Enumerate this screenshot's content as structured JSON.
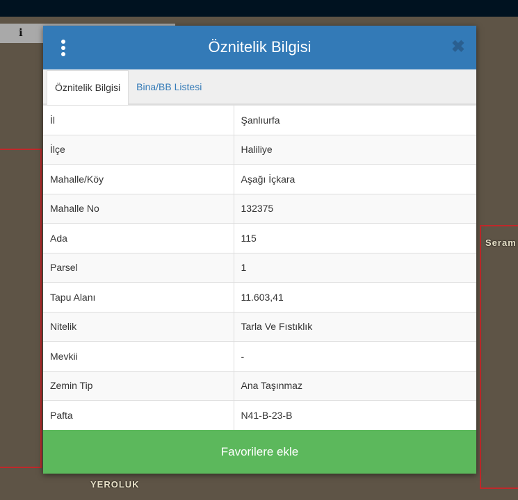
{
  "map": {
    "labels": [
      "Seram",
      "YEROLUK"
    ],
    "toolbar_info_icon": "i"
  },
  "modal": {
    "title": "Öznitelik Bilgisi",
    "tabs": [
      {
        "label": "Öznitelik Bilgisi",
        "active": true
      },
      {
        "label": "Bina/BB Listesi",
        "active": false
      }
    ],
    "rows": [
      {
        "key": "İl",
        "value": "Şanlıurfa"
      },
      {
        "key": "İlçe",
        "value": "Haliliye"
      },
      {
        "key": "Mahalle/Köy",
        "value": "Aşağı İçkara"
      },
      {
        "key": "Mahalle No",
        "value": "132375"
      },
      {
        "key": "Ada",
        "value": "115"
      },
      {
        "key": "Parsel",
        "value": "1"
      },
      {
        "key": "Tapu Alanı",
        "value": "11.603,41"
      },
      {
        "key": "Nitelik",
        "value": "Tarla Ve Fıstıklık"
      },
      {
        "key": "Mevkii",
        "value": "-"
      },
      {
        "key": "Zemin Tip",
        "value": "Ana Taşınmaz"
      },
      {
        "key": "Pafta",
        "value": "N41-B-23-B"
      }
    ],
    "favorite_button": "Favorilere ekle"
  },
  "colors": {
    "header": "#337ab7",
    "button": "#5cb85c"
  }
}
